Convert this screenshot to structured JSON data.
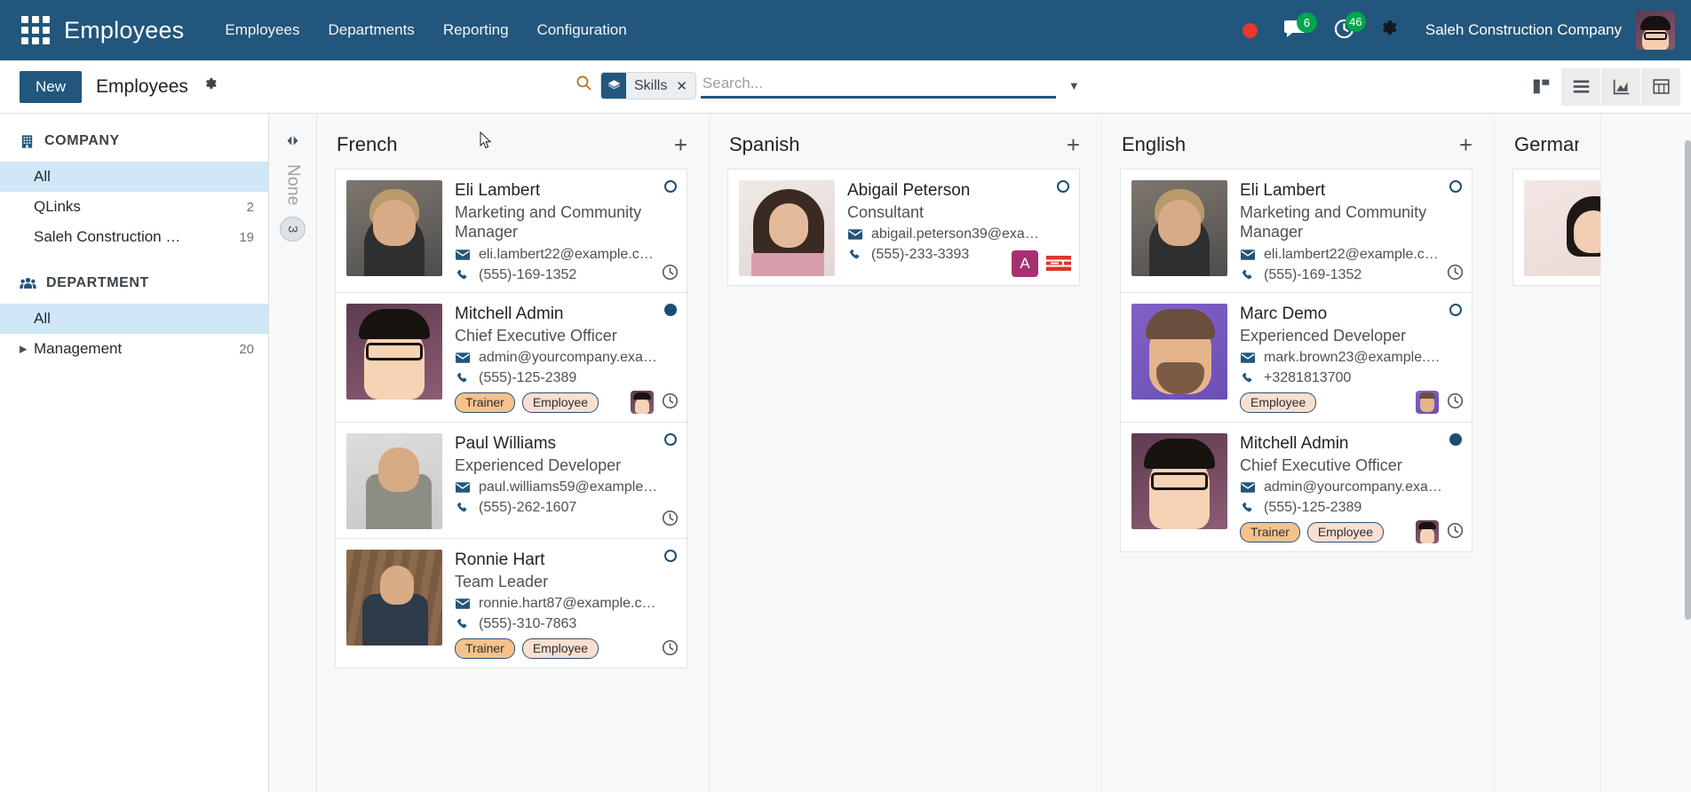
{
  "navbar": {
    "apps_icon": "apps-grid-icon",
    "brand": "Employees",
    "menu": [
      {
        "label": "Employees"
      },
      {
        "label": "Departments"
      },
      {
        "label": "Reporting"
      },
      {
        "label": "Configuration"
      }
    ],
    "messages_icon": "chat-bubble-icon",
    "messages_count": "6",
    "activities_icon": "clock-activity-icon",
    "activities_count": "46",
    "settings_icon": "gear-icon",
    "company": "Saleh Construction Company",
    "avatar": "user-avatar"
  },
  "control_panel": {
    "new_label": "New",
    "breadcrumb": "Employees",
    "gear_icon": "gear-icon",
    "search": {
      "icon": "search-icon",
      "facet_icon": "layers-icon",
      "facet_label": "Skills",
      "facet_remove_icon": "close-icon",
      "value": "",
      "placeholder": "Search...",
      "dropdown_icon": "chevron-down-icon"
    },
    "views": [
      {
        "name": "kanban",
        "label": "Kanban",
        "active": true
      },
      {
        "name": "list",
        "label": "List",
        "active": false
      },
      {
        "name": "graph",
        "label": "Graph",
        "active": false
      },
      {
        "name": "pivot",
        "label": "Pivot",
        "active": false
      }
    ]
  },
  "sidebar": {
    "sections": [
      {
        "icon": "building-icon",
        "title": "COMPANY",
        "items": [
          {
            "label": "All",
            "count": "",
            "selected": true,
            "expandable": false
          },
          {
            "label": "QLinks",
            "count": "2",
            "selected": false,
            "expandable": false
          },
          {
            "label": "Saleh Construction …",
            "count": "19",
            "selected": false,
            "expandable": false
          }
        ]
      },
      {
        "icon": "people-icon",
        "title": "DEPARTMENT",
        "items": [
          {
            "label": "All",
            "count": "",
            "selected": true,
            "expandable": false
          },
          {
            "label": "Management",
            "count": "20",
            "selected": false,
            "expandable": true
          }
        ]
      }
    ]
  },
  "kanban": {
    "collapsed_column": {
      "title": "None",
      "count": "3",
      "expand_icon": "expand-columns-icon"
    },
    "add_icon": "plus-icon",
    "clock_icon": "clock-icon",
    "mail_icon": "envelope-icon",
    "phone_icon": "phone-icon",
    "columns": [
      {
        "title": "French",
        "cards": [
          {
            "name": "Eli Lambert",
            "job": "Marketing and Community Manager",
            "email": "eli.lambert22@example.com",
            "phone": "(555)-169-1352",
            "tags": [],
            "status": "ring",
            "photo": "ph-eli",
            "mini_avatar": null,
            "badge_letter": null,
            "flag": false
          },
          {
            "name": "Mitchell Admin",
            "job": "Chief Executive Officer",
            "email": "admin@yourcompany.example....",
            "phone": "(555)-125-2389",
            "tags": [
              {
                "label": "Trainer",
                "style": "trainer"
              },
              {
                "label": "Employee",
                "style": "employee"
              }
            ],
            "status": "filled",
            "photo": "ph-mitchell",
            "mini_avatar": "mini-mitchell",
            "badge_letter": null,
            "flag": false
          },
          {
            "name": "Paul Williams",
            "job": "Experienced Developer",
            "email": "paul.williams59@example.com",
            "phone": "(555)-262-1607",
            "tags": [],
            "status": "ring",
            "photo": "ph-paul",
            "mini_avatar": null,
            "badge_letter": null,
            "flag": false
          },
          {
            "name": "Ronnie Hart",
            "job": "Team Leader",
            "email": "ronnie.hart87@example.com",
            "phone": "(555)-310-7863",
            "tags": [
              {
                "label": "Trainer",
                "style": "trainer"
              },
              {
                "label": "Employee",
                "style": "employee"
              }
            ],
            "status": "ring",
            "photo": "ph-ronnie",
            "mini_avatar": null,
            "badge_letter": null,
            "flag": false
          }
        ]
      },
      {
        "title": "Spanish",
        "cards": [
          {
            "name": "Abigail Peterson",
            "job": "Consultant",
            "email": "abigail.peterson39@example.c...",
            "phone": "(555)-233-3393",
            "tags": [],
            "status": "ring",
            "photo": "ph-abigail",
            "mini_avatar": null,
            "badge_letter": "A",
            "flag": true
          }
        ]
      },
      {
        "title": "English",
        "cards": [
          {
            "name": "Eli Lambert",
            "job": "Marketing and Community Manager",
            "email": "eli.lambert22@example.com",
            "phone": "(555)-169-1352",
            "tags": [],
            "status": "ring",
            "photo": "ph-eli",
            "mini_avatar": null,
            "badge_letter": null,
            "flag": false
          },
          {
            "name": "Marc Demo",
            "job": "Experienced Developer",
            "email": "mark.brown23@example.com",
            "phone": "+3281813700",
            "tags": [
              {
                "label": "Employee",
                "style": "employee"
              }
            ],
            "status": "ring",
            "photo": "ph-marc",
            "mini_avatar": "mini-marc",
            "badge_letter": null,
            "flag": false
          },
          {
            "name": "Mitchell Admin",
            "job": "Chief Executive Officer",
            "email": "admin@yourcompany.example....",
            "phone": "(555)-125-2389",
            "tags": [
              {
                "label": "Trainer",
                "style": "trainer"
              },
              {
                "label": "Employee",
                "style": "employee"
              }
            ],
            "status": "filled",
            "photo": "ph-mitchell",
            "mini_avatar": "mini-mitchell",
            "badge_letter": null,
            "flag": false
          }
        ]
      },
      {
        "title": "German",
        "partial": true,
        "cards": [
          {
            "name": "",
            "job": "",
            "email": "",
            "phone": "",
            "tags": [],
            "status": "",
            "photo": "ph-german",
            "mini_avatar": null,
            "badge_letter": null,
            "flag": false
          }
        ]
      }
    ]
  },
  "colors": {
    "brand": "#22567c",
    "badge_green": "#00a54f",
    "status_red": "#e8372c",
    "tag_trainer": "#f6c28c",
    "tag_employee": "#fadfd0",
    "sidebar_selected": "#cfe7f7"
  }
}
